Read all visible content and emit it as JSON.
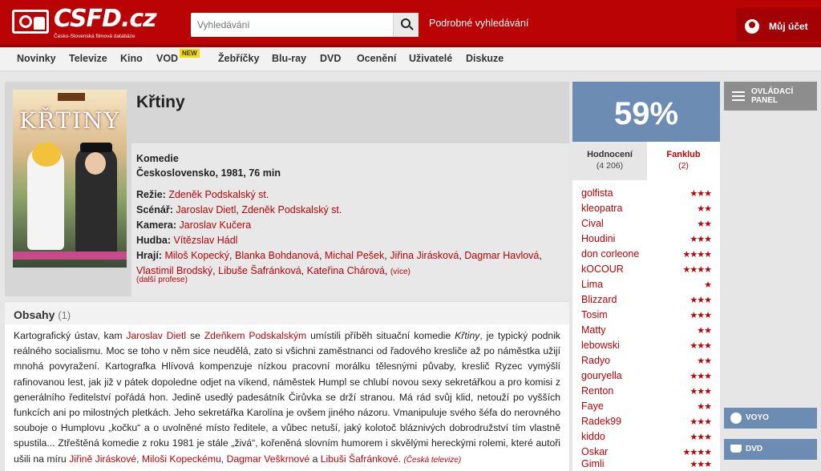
{
  "header": {
    "logo_text": "CSFD.cz",
    "logo_sub": "Česko-Slovenská filmová databáze",
    "search_placeholder": "Vyhledávání",
    "advanced_search": "Podrobné vyhledávání",
    "account": "Můj účet"
  },
  "nav": {
    "items": [
      "Novinky",
      "Televize",
      "Kino",
      "VOD",
      "Žebříčky",
      "Blu-ray",
      "DVD",
      "Ocenění",
      "Uživatelé",
      "Diskuze"
    ],
    "vod_badge": "NEW"
  },
  "film": {
    "poster_title": "KŘTINY",
    "title": "Křtiny",
    "genre": "Komedie",
    "origin": "Československo, 1981, 76 min",
    "labels": {
      "directing": "Režie:",
      "screenplay": "Scénář:",
      "camera": "Kamera:",
      "music": "Hudba:",
      "cast": "Hrají:"
    },
    "director": "Zdeněk Podskalský st.",
    "writers": [
      "Jaroslav Dietl",
      "Zdeněk Podskalský st."
    ],
    "camera": "Jaroslav Kučera",
    "music": "Vítězslav Hádl",
    "cast": [
      "Miloš Kopecký",
      "Blanka Bohdanová",
      "Michal Pešek",
      "Jiřina Jirásková",
      "Dagmar Havlová",
      "Vlastimil Brodský",
      "Libuše Šafránková",
      "Kateřina Chárová"
    ],
    "more_cast": "(více)",
    "more_professions": "(další profese)"
  },
  "plot": {
    "title": "Obsahy",
    "count": "(1)",
    "text_parts": [
      "Kartografický ústav, kam ",
      "Jaroslav Dietl",
      " se ",
      "Zdeňkem Podskalským",
      " umístili příběh situační komedie ",
      "Křtiny",
      ", je typický podnik reálného socialismu. Moc se toho v něm sice neudělá, zato si všichni zaměstnanci od řadového kresliče až po náměstka užijí mnohá povyražení. Kartografka Hlívová kompenzuje nízkou pracovní morálku tělesnými půvaby, kreslič Ryzec vymýšlí rafinovanou lest, jak již v pátek dopoledne odjet na víkend, náměstek Humpl se chlubí novou sexy sekretářkou a pro komisi z generálního ředitelství pořádá hon. Jedině usedlý padesátník Čirůvka se drží stranou. Má rád svůj klid, netouží po vyšších funkcích ani po milostných pletkách. Jeho sekretářka Karolína je ovšem jiného názoru. Vmanipuluje svého šéfa do nerovného souboje o Humplovu „kočku“ a o uvolněné místo ředitele, a vůbec netuší, jaký kolotoč bláznivých dobrodružství tím vlastně spustila... Ztřeštěná komedie z roku 1981 je stále „živá“, kořeněná slovním humorem i skvělými hereckými rolemi, které autoři ušili na míru ",
      "Jiřině Jiráskové",
      ", ",
      "Miloši Kopeckému",
      ", ",
      "Dagmar Veškrnové",
      " a ",
      "Libuši Šafránkové",
      ". ",
      "(Česká televize)"
    ]
  },
  "rating": {
    "value": "59%",
    "color": "#6c8cb4",
    "tabs": [
      {
        "label": "Hodnocení",
        "count": "(4 206)"
      },
      {
        "label": "Fanklub",
        "count": "(2)"
      }
    ],
    "users": [
      {
        "name": "golfista",
        "stars": "★★★"
      },
      {
        "name": "kleopatra",
        "stars": "★★"
      },
      {
        "name": "Cival",
        "stars": "★★"
      },
      {
        "name": "Houdini",
        "stars": "★★★"
      },
      {
        "name": "don corleone",
        "stars": "★★★★"
      },
      {
        "name": "kOCOUR",
        "stars": "★★★★"
      },
      {
        "name": "Lima",
        "stars": "★"
      },
      {
        "name": "Blizzard",
        "stars": "★★★"
      },
      {
        "name": "Tosim",
        "stars": "★★★"
      },
      {
        "name": "Matty",
        "stars": "★★"
      },
      {
        "name": "lebowski",
        "stars": "★★★"
      },
      {
        "name": "Radyo",
        "stars": "★★"
      },
      {
        "name": "gouryella",
        "stars": "★★★"
      },
      {
        "name": "Renton",
        "stars": "★★★"
      },
      {
        "name": "Faye",
        "stars": "★★"
      },
      {
        "name": "Radek99",
        "stars": "★★★"
      },
      {
        "name": "kiddo",
        "stars": "★★★"
      },
      {
        "name": "Oskar",
        "stars": "★★★★"
      },
      {
        "name": "Gimli",
        "stars": "★★★"
      }
    ]
  },
  "sidebar": {
    "control_panel": "OVLÁDACÍ PANEL",
    "voyo": "VOYO",
    "dvd": "DVD"
  }
}
